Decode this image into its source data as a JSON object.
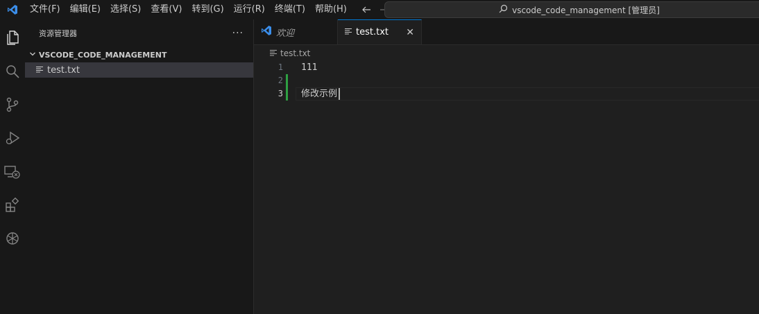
{
  "menu": [
    "文件(F)",
    "编辑(E)",
    "选择(S)",
    "查看(V)",
    "转到(G)",
    "运行(R)",
    "终端(T)",
    "帮助(H)"
  ],
  "search": {
    "text": "vscode_code_management [管理员]"
  },
  "sidebar": {
    "title": "资源管理器",
    "more": "···",
    "folder": "VSCODE_CODE_MANAGEMENT",
    "files": [
      "test.txt"
    ]
  },
  "tabs": [
    {
      "label": "欢迎"
    },
    {
      "label": "test.txt",
      "close": "✕"
    }
  ],
  "breadcrumb": {
    "file": "test.txt"
  },
  "editor": {
    "lines": [
      {
        "number": "1",
        "text": "111"
      },
      {
        "number": "2",
        "text": ""
      },
      {
        "number": "3",
        "text": "修改示例"
      }
    ]
  },
  "colors": {
    "accent": "#0078d4",
    "modified_gutter": "#2ea043",
    "vscode_logo": "#3b8eea"
  }
}
